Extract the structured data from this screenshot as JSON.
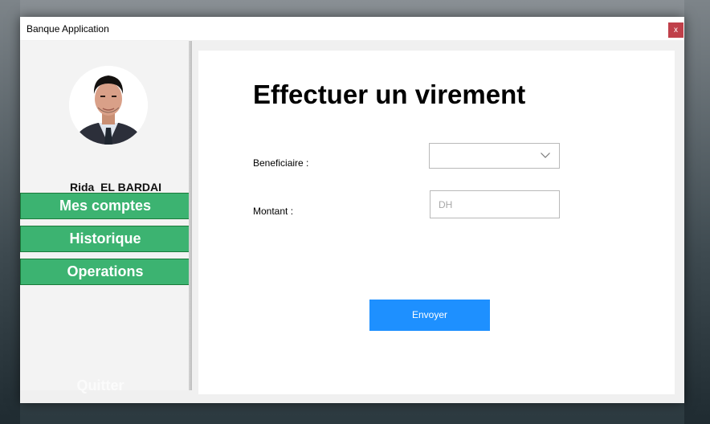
{
  "window": {
    "title": "Banque Application",
    "close_label": "x"
  },
  "sidebar": {
    "user_name": "Rida  EL BARDAI",
    "nav": [
      {
        "label": "Mes comptes"
      },
      {
        "label": "Historique"
      },
      {
        "label": "Operations"
      }
    ],
    "quit_label": "Quitter"
  },
  "main": {
    "title": "Effectuer un virement",
    "beneficiaire_label": "Beneficiaire :",
    "beneficiaire_value": "",
    "montant_label": "Montant :",
    "montant_placeholder": "DH",
    "montant_value": "",
    "send_label": "Envoyer"
  },
  "colors": {
    "nav_green": "#3cb371",
    "send_blue": "#1e90ff",
    "close_red": "#c0404a"
  },
  "icons": {
    "dropdown": "chevron-down-icon"
  }
}
